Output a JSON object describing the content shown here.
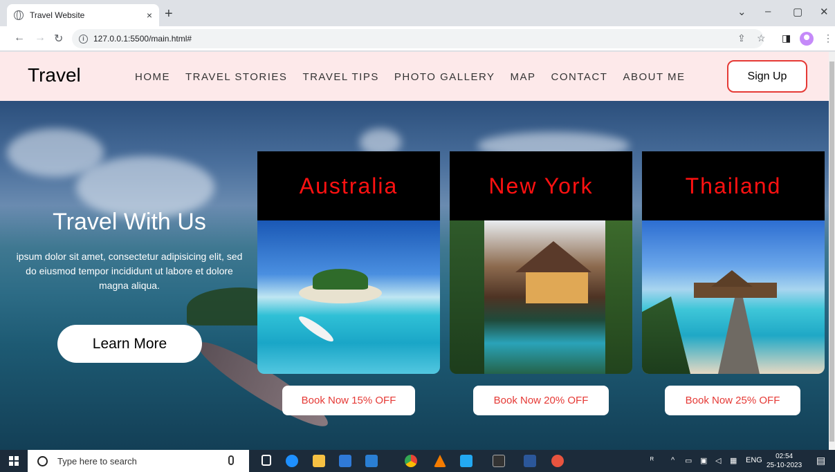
{
  "browser": {
    "tab_title": "Travel Website",
    "tab_close": "×",
    "new_tab": "+",
    "url": "127.0.0.1:5500/main.html#",
    "win_minimize": "–",
    "win_restore": "▢",
    "win_close": "✕",
    "win_chevron": "⌄"
  },
  "site": {
    "logo": "Travel",
    "menu": [
      "HOME",
      "TRAVEL STORIES",
      "TRAVEL TIPS",
      "PHOTO GALLERY",
      "MAP",
      "CONTACT",
      "ABOUT ME"
    ],
    "signup": "Sign Up"
  },
  "hero": {
    "title": "Travel With Us",
    "description": "ipsum dolor sit amet, consectetur adipisicing elit, sed do eiusmod tempor incididunt ut labore et dolore magna aliqua.",
    "cta": "Learn More"
  },
  "cards": [
    {
      "title": "Australia",
      "offer": "Book Now 15% OFF"
    },
    {
      "title": "New York",
      "offer": "Book Now 20% OFF"
    },
    {
      "title": "Thailand",
      "offer": "Book Now 25% OFF"
    }
  ],
  "taskbar": {
    "search_placeholder": "Type here to search",
    "lang": "ENG",
    "time": "02:54",
    "date": "25-10-2023"
  },
  "colors": {
    "nav_bg": "#fde9ea",
    "accent_red": "#ff1111",
    "button_red": "#e53935"
  }
}
